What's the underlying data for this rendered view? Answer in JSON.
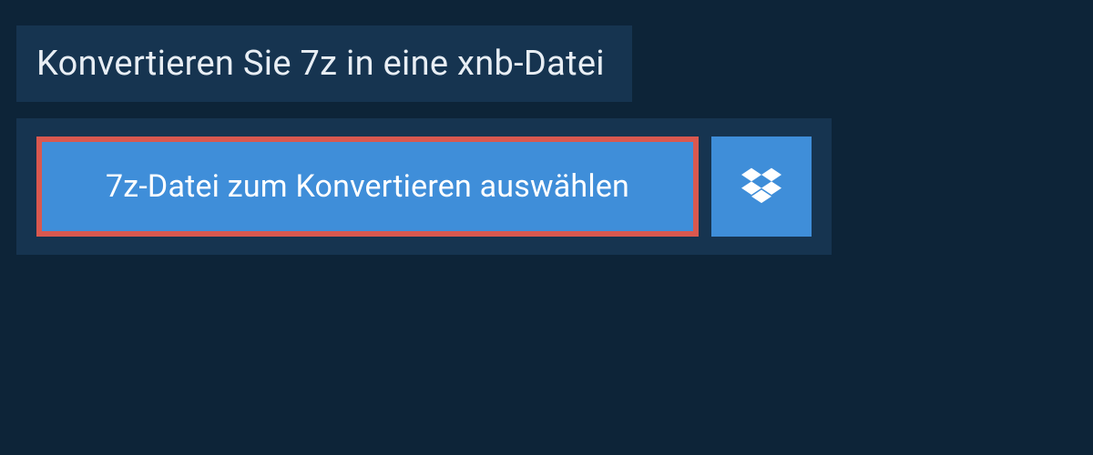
{
  "header": {
    "title": "Konvertieren Sie 7z in eine xnb-Datei"
  },
  "upload": {
    "select_label": "7z-Datei zum Konvertieren auswählen"
  },
  "colors": {
    "background": "#0d2438",
    "panel": "#163450",
    "button": "#3f8ed9",
    "highlight_border": "#d9584f"
  }
}
